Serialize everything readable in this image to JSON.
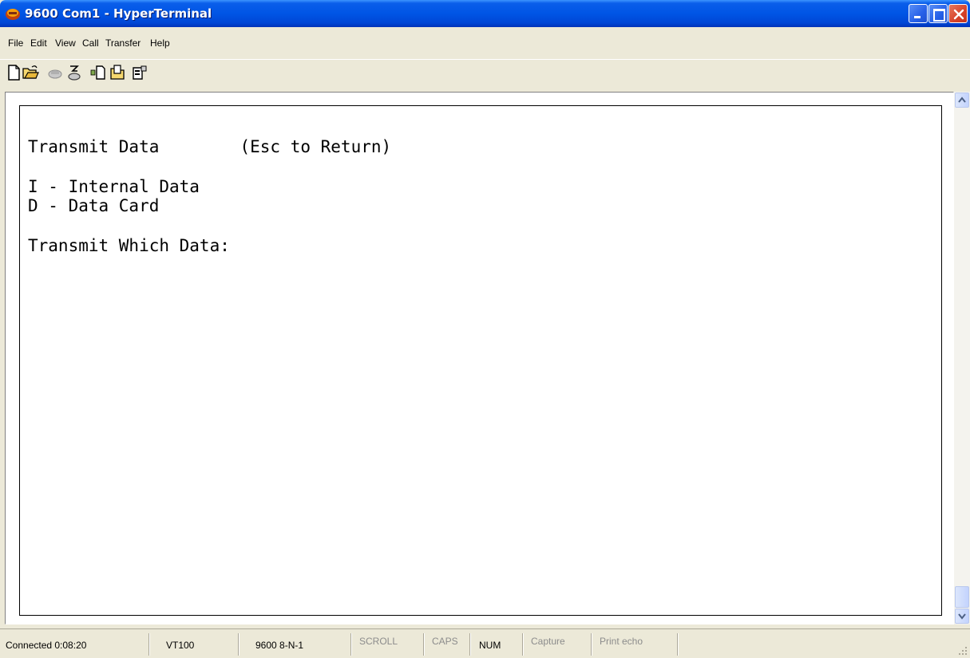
{
  "window": {
    "title": "9600 Com1 - HyperTerminal",
    "title_color": "#0055E5"
  },
  "menu": {
    "items": [
      "File",
      "Edit",
      "View",
      "Call",
      "Transfer",
      "Help"
    ]
  },
  "toolbar": {
    "icons": [
      "new-icon",
      "open-icon",
      "connect-icon",
      "disconnect-icon",
      "send-icon",
      "receive-icon",
      "properties-icon"
    ]
  },
  "terminal": {
    "lines": [
      "Transmit Data        (Esc to Return)",
      "I - Internal Data",
      "D - Data Card",
      "Transmit Which Data:"
    ]
  },
  "status": {
    "connected": "Connected 0:08:20",
    "emulation": "VT100",
    "settings": "9600 8-N-1",
    "scroll": "SCROLL",
    "caps": "CAPS",
    "num": "NUM",
    "capture": "Capture",
    "print_echo": "Print echo"
  }
}
